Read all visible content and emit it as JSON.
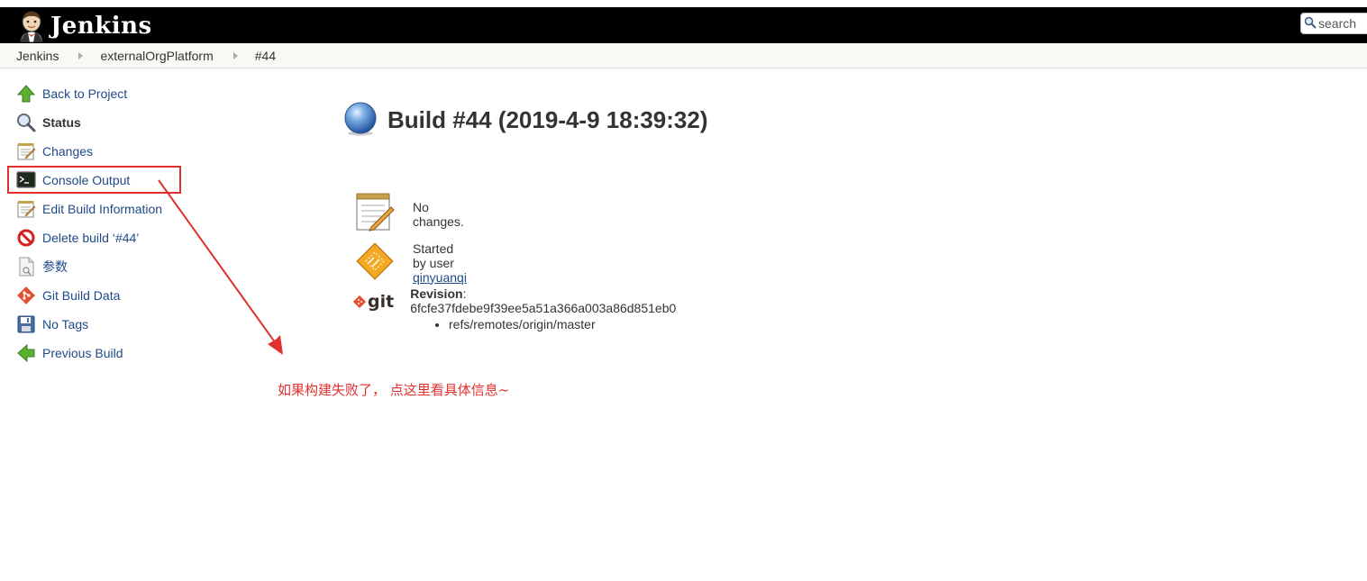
{
  "header": {
    "app_name": "Jenkins",
    "search_placeholder": "search"
  },
  "breadcrumb": [
    {
      "label": "Jenkins"
    },
    {
      "label": "externalOrgPlatform"
    },
    {
      "label": "#44"
    }
  ],
  "sidebar": {
    "items": [
      {
        "label": "Back to Project",
        "icon": "up-arrow-icon"
      },
      {
        "label": "Status",
        "icon": "magnifier-icon"
      },
      {
        "label": "Changes",
        "icon": "notepad-icon"
      },
      {
        "label": "Console Output",
        "icon": "terminal-icon"
      },
      {
        "label": "Edit Build Information",
        "icon": "notepad-icon"
      },
      {
        "label": "Delete build ‘#44’",
        "icon": "no-entry-icon"
      },
      {
        "label": "参数",
        "icon": "document-icon"
      },
      {
        "label": "Git Build Data",
        "icon": "git-icon"
      },
      {
        "label": "No Tags",
        "icon": "floppy-icon"
      },
      {
        "label": "Previous Build",
        "icon": "left-arrow-icon"
      }
    ]
  },
  "build": {
    "title": "Build #44 (2019-4-9 18:39:32)",
    "status_color": "#4a90d9",
    "changes_text": "No changes.",
    "started_by_prefix": "Started by user ",
    "started_by_user": "qinyuanqi",
    "revision_label": "Revision",
    "revision_value": ": 6fcfe37fdebe9f39ee5a51a366a003a86d851eb0",
    "refs": [
      "refs/remotes/origin/master"
    ],
    "git_label": "git"
  },
  "annotation": {
    "text": "如果构建失败了， 点这里看具体信息~",
    "color": "#e0312f"
  }
}
